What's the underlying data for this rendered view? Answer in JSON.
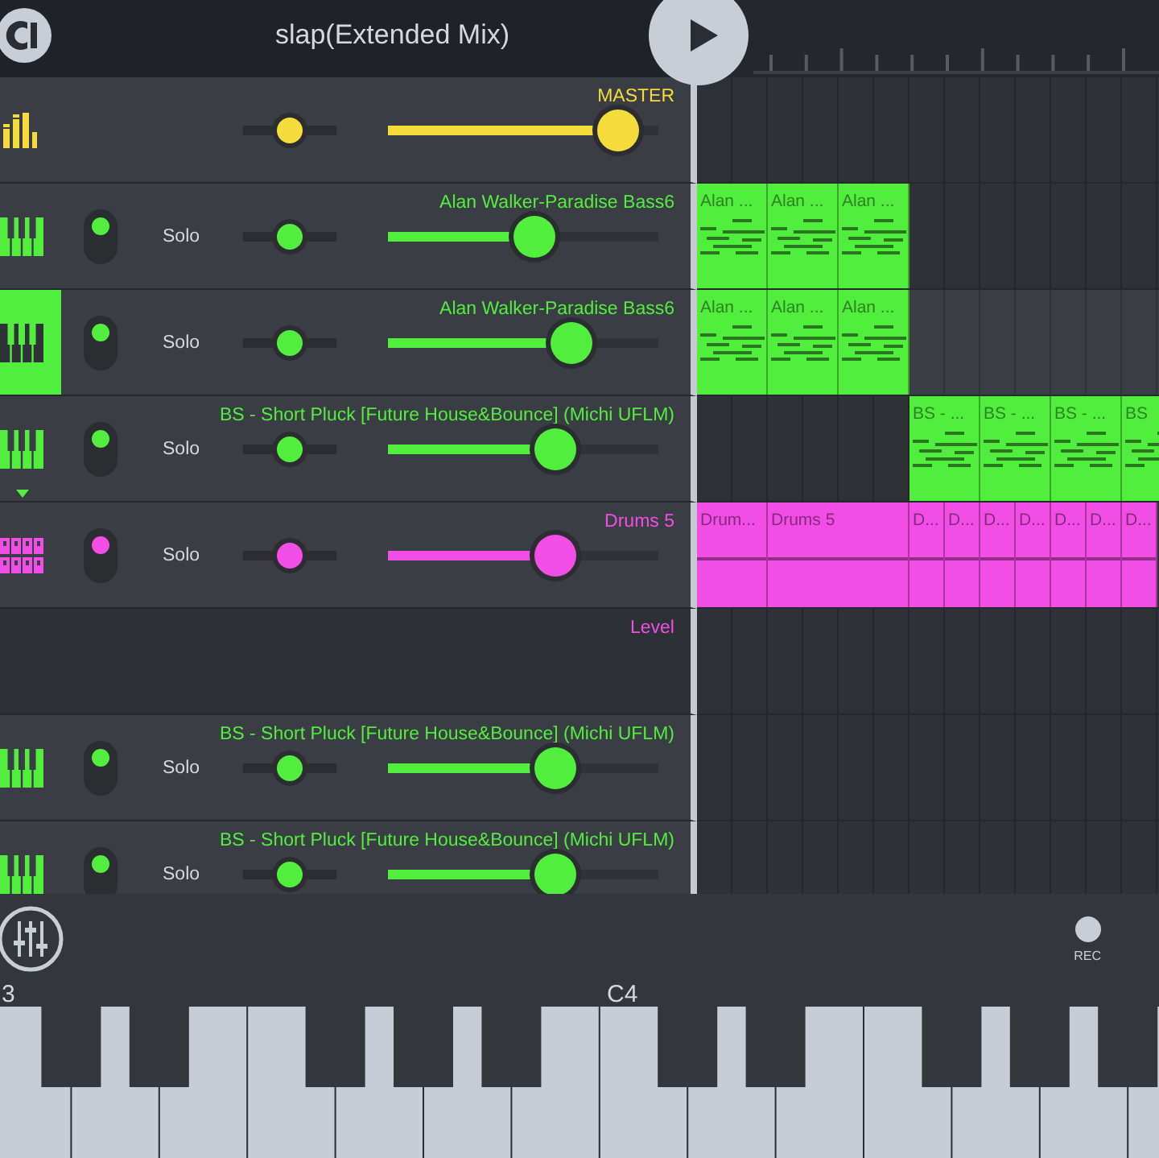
{
  "header": {
    "title": "slap(Extended Mix)"
  },
  "tracks": [
    {
      "kind": "master",
      "name": "MASTER",
      "color": "#f5dc3b",
      "pan": {
        "level": 0.5
      },
      "volume": {
        "level": 0.85
      }
    },
    {
      "kind": "instrument",
      "name": "Alan Walker-Paradise Bass6",
      "color": "#52ee3e",
      "selected": false,
      "on": true,
      "solo": "Solo",
      "pan": {
        "level": 0.5
      },
      "volume": {
        "level": 0.54
      },
      "clips": [
        {
          "kind": "pattern",
          "label": "Alan ..."
        },
        {
          "kind": "pattern",
          "label": "Alan ..."
        },
        {
          "kind": "pattern",
          "label": "Alan ..."
        }
      ]
    },
    {
      "kind": "instrument",
      "name": "Alan Walker-Paradise Bass6",
      "color": "#52ee3e",
      "selected": true,
      "on": true,
      "solo": "Solo",
      "pan": {
        "level": 0.5
      },
      "volume": {
        "level": 0.68
      },
      "clips": [
        {
          "kind": "pattern",
          "label": "Alan ..."
        },
        {
          "kind": "pattern",
          "label": "Alan ..."
        },
        {
          "kind": "pattern",
          "label": "Alan ..."
        }
      ]
    },
    {
      "kind": "instrument",
      "name": "BS - Short Pluck [Future House&Bounce] (Michi UFLM)",
      "color": "#52ee3e",
      "selected": false,
      "expanded": true,
      "on": true,
      "solo": "Solo",
      "pan": {
        "level": 0.5
      },
      "volume": {
        "level": 0.62
      },
      "clips": [
        {
          "kind": "empty"
        },
        {
          "kind": "empty"
        },
        {
          "kind": "empty"
        },
        {
          "kind": "pattern",
          "label": "BS - ..."
        },
        {
          "kind": "pattern",
          "label": "BS - ..."
        },
        {
          "kind": "pattern",
          "label": "BS - ..."
        },
        {
          "kind": "pattern",
          "label": "BS"
        }
      ]
    },
    {
      "kind": "drums",
      "name": "Drums 5",
      "color": "#f24ee6",
      "selected": false,
      "on": true,
      "solo": "Solo",
      "pan": {
        "level": 0.5
      },
      "volume": {
        "level": 0.62
      },
      "clips": [
        {
          "kind": "pattern",
          "label": "Drum..."
        },
        {
          "kind": "long",
          "label": "Drums 5"
        },
        {
          "kind": "short",
          "label": "D..."
        },
        {
          "kind": "short",
          "label": "D..."
        },
        {
          "kind": "short",
          "label": "D..."
        },
        {
          "kind": "short",
          "label": "D..."
        },
        {
          "kind": "short",
          "label": "D..."
        },
        {
          "kind": "short",
          "label": "D..."
        },
        {
          "kind": "short",
          "label": "D..."
        }
      ]
    },
    {
      "kind": "automation",
      "name": "Level",
      "color": "#f24ee6"
    },
    {
      "kind": "instrument",
      "name": "BS - Short Pluck [Future House&Bounce] (Michi UFLM)",
      "color": "#52ee3e",
      "selected": false,
      "on": true,
      "solo": "Solo",
      "pan": {
        "level": 0.5
      },
      "volume": {
        "level": 0.62
      }
    },
    {
      "kind": "instrument",
      "name": "BS - Short Pluck [Future House&Bounce] (Michi UFLM)",
      "color": "#52ee3e",
      "selected": false,
      "on": true,
      "solo": "Solo",
      "pan": {
        "level": 0.5
      },
      "volume": {
        "level": 0.62
      }
    }
  ],
  "toolbar": {
    "rec_label": "REC"
  },
  "keyboard": {
    "labels": [
      "3",
      "C4"
    ]
  }
}
